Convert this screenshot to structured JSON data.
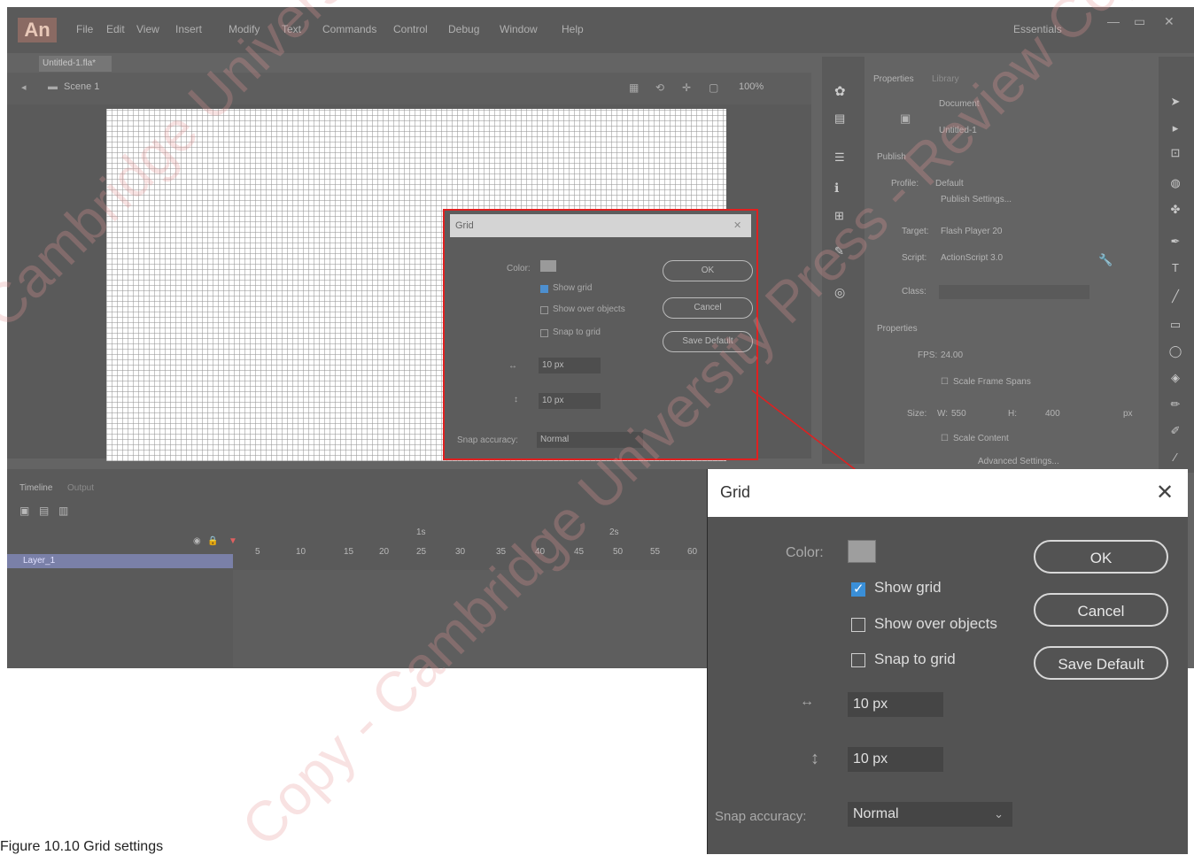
{
  "app": {
    "logo": "An",
    "menu": [
      "File",
      "Edit",
      "View",
      "Insert",
      "Modify",
      "Text",
      "Commands",
      "Control",
      "Debug",
      "Window",
      "Help"
    ],
    "workspace": "Essentials",
    "doc_tab": "Untitled-1.fla*",
    "scene": "Scene 1",
    "zoom": "100%"
  },
  "small_dialog": {
    "title": "Grid",
    "color_label": "Color:",
    "show_grid": "Show grid",
    "show_over_objects": "Show over objects",
    "snap_to_grid": "Snap to grid",
    "width_value": "10 px",
    "height_value": "10 px",
    "snap_accuracy_label": "Snap accuracy:",
    "snap_accuracy_value": "Normal",
    "ok": "OK",
    "cancel": "Cancel",
    "save_default": "Save Default"
  },
  "properties": {
    "tab_properties": "Properties",
    "tab_library": "Library",
    "doc_type": "Document",
    "doc_name": "Untitled-1",
    "publish_section": "Publish",
    "profile_label": "Profile:",
    "profile_value": "Default",
    "publish_settings": "Publish Settings...",
    "target_label": "Target:",
    "target_value": "Flash Player 20",
    "script_label": "Script:",
    "script_value": "ActionScript 3.0",
    "class_label": "Class:",
    "properties_section": "Properties",
    "fps_label": "FPS:",
    "fps_value": "24.00",
    "scale_spans": "Scale Frame Spans",
    "size_label": "Size:",
    "size_w_label": "W:",
    "size_w": "550",
    "size_h_label": "H:",
    "size_h": "400",
    "size_unit": "px",
    "scale_content": "Scale Content",
    "advanced_settings": "Advanced Settings..."
  },
  "timeline": {
    "tab_timeline": "Timeline",
    "tab_output": "Output",
    "layer_name": "Layer_1",
    "frame_numbers": [
      "5",
      "10",
      "15",
      "20",
      "25",
      "30",
      "35",
      "40",
      "45",
      "50",
      "55",
      "60"
    ],
    "time_marks": [
      "1s",
      "2s"
    ]
  },
  "big_dialog": {
    "title": "Grid",
    "close": "✕",
    "color_label": "Color:",
    "swatch_color": "#9e9e9e",
    "show_grid": "Show grid",
    "show_grid_checked": true,
    "show_over_objects": "Show over objects",
    "show_over_objects_checked": false,
    "snap_to_grid": "Snap to grid",
    "snap_to_grid_checked": false,
    "width_value": "10 px",
    "height_value": "10 px",
    "snap_accuracy_label": "Snap accuracy:",
    "snap_accuracy_value": "Normal",
    "ok": "OK",
    "cancel": "Cancel",
    "save_default": "Save Default"
  },
  "highlight_color": "#e02020",
  "caption": "Figure 10.10 Grid settings",
  "watermark": "Copy - Cambridge University Press - Review Copy"
}
